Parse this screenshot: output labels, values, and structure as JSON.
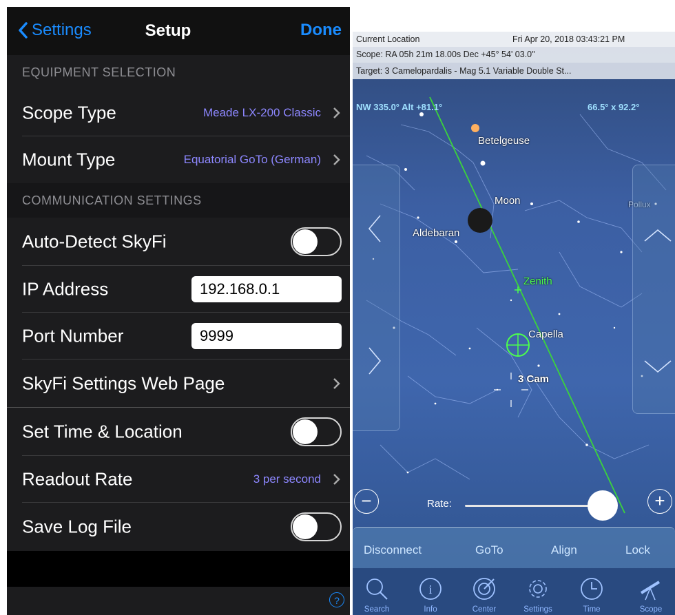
{
  "setup": {
    "nav": {
      "back_label": "Settings",
      "title": "Setup",
      "done_label": "Done"
    },
    "sections": {
      "equipment": "EQUIPMENT SELECTION",
      "communication": "COMMUNICATION SETTINGS"
    },
    "rows": {
      "scope_type": {
        "label": "Scope Type",
        "value": "Meade LX-200 Classic"
      },
      "mount_type": {
        "label": "Mount Type",
        "value": "Equatorial GoTo (German)"
      },
      "auto_detect": {
        "label": "Auto-Detect SkyFi",
        "on": false
      },
      "ip_address": {
        "label": "IP Address",
        "value": "192.168.0.1"
      },
      "port_number": {
        "label": "Port Number",
        "value": "9999"
      },
      "web_page": {
        "label": "SkyFi Settings Web Page"
      },
      "set_time": {
        "label": "Set Time & Location",
        "on": false
      },
      "readout_rate": {
        "label": "Readout Rate",
        "value": "3 per second"
      },
      "save_log": {
        "label": "Save Log File",
        "on": false
      }
    },
    "help_label": "?"
  },
  "skymap": {
    "info": {
      "location": "Current Location",
      "datetime": "Fri Apr 20, 2018  03:43:21 PM",
      "scope": "Scope: RA 05h 21m 18.00s   Dec +45° 54' 03.0\"",
      "target": "Target: 3 Camelopardalis - Mag 5.1 Variable Double St..."
    },
    "view": {
      "direction": "NW 335.0° Alt +81.1°",
      "fov": "66.5° x 92.2°"
    },
    "labels": {
      "betelgeuse": "Betelgeuse",
      "moon": "Moon",
      "aldebaran": "Aldebaran",
      "pollux": "Pollux",
      "zenith": "Zenith",
      "capella": "Capella",
      "target": "3 Cam"
    },
    "rate_label": "Rate:",
    "rate_level": 1.0,
    "commands": [
      "Disconnect",
      "GoTo",
      "Align",
      "Lock"
    ],
    "tabs": [
      "Search",
      "Info",
      "Center",
      "Settings",
      "Time",
      "Scope"
    ],
    "colors": {
      "ios_blue": "#1a8cff",
      "value_purple": "#8d87ff",
      "zenith_green": "#4cff4c",
      "sky": "#3c5fa3"
    }
  }
}
